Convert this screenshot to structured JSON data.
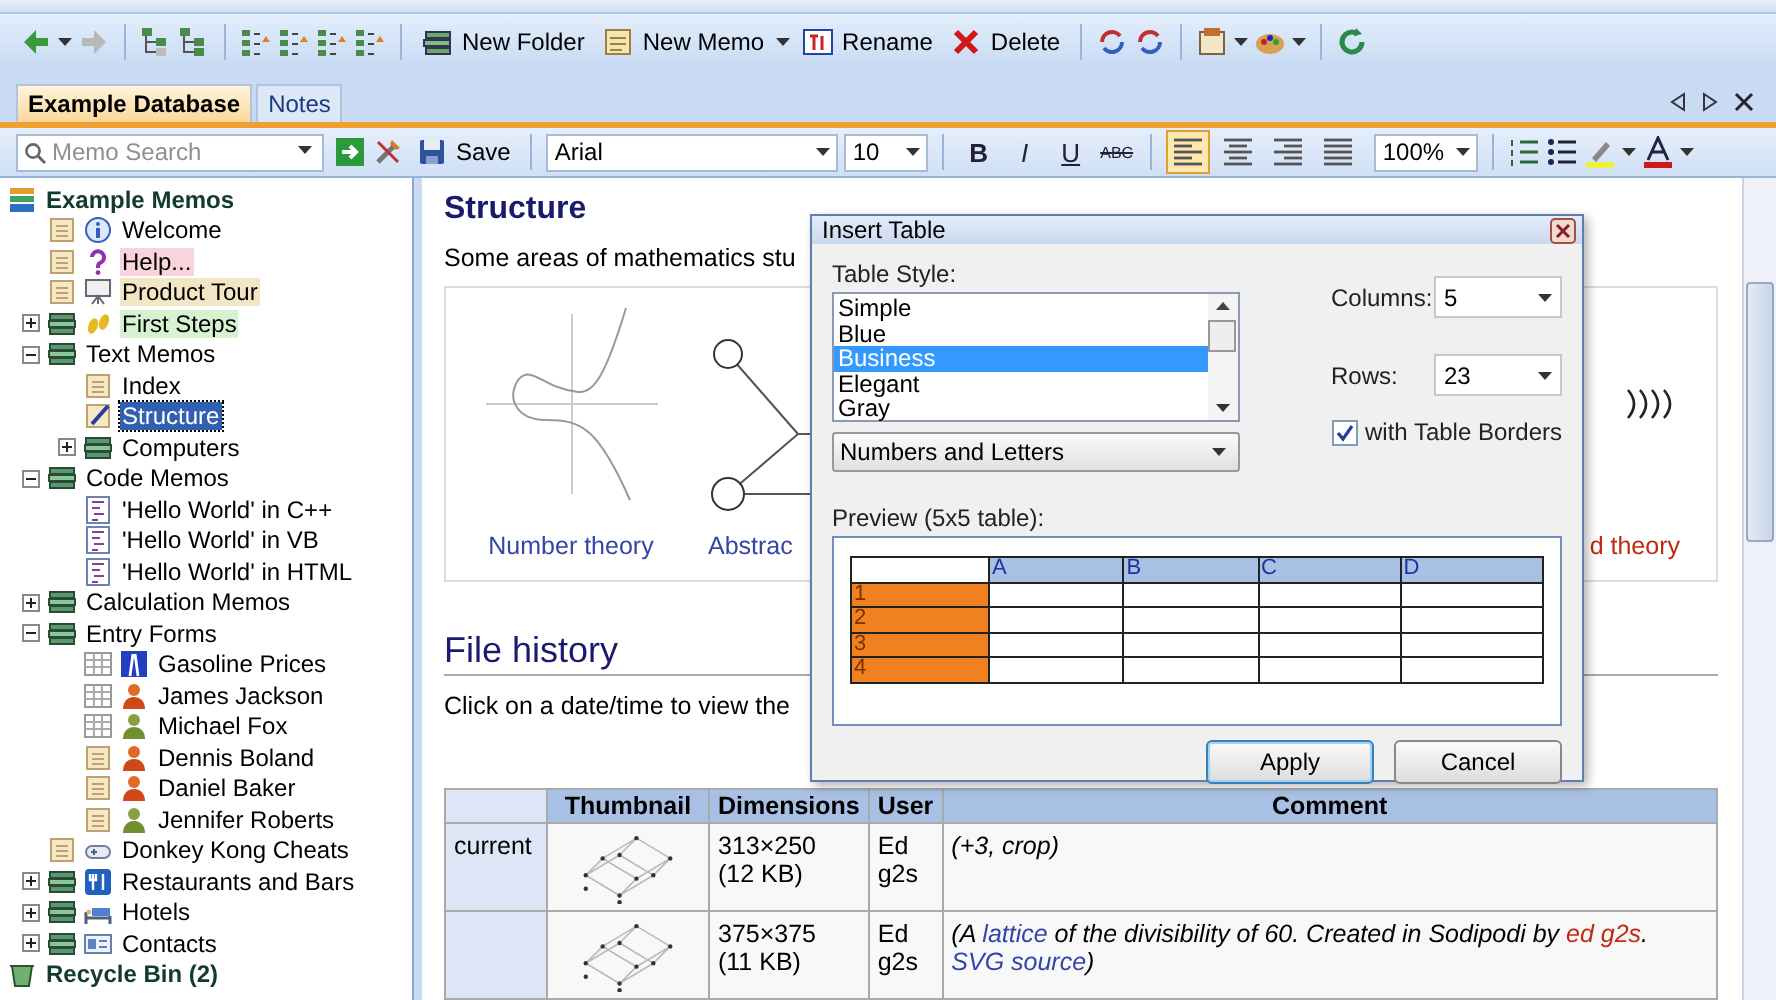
{
  "toolbar": {
    "buttons": [
      {
        "label": "New Folder",
        "kind": "folder",
        "dropdown": false
      },
      {
        "label": "New Memo",
        "kind": "memo",
        "dropdown": true
      },
      {
        "label": "Rename",
        "kind": "rename",
        "dropdown": false
      },
      {
        "label": "Delete",
        "kind": "delete",
        "dropdown": false
      }
    ]
  },
  "tabs": [
    {
      "label": "Example Database",
      "selected": true
    },
    {
      "label": "Notes",
      "selected": false
    }
  ],
  "format_bar": {
    "search": {
      "placeholder": "Memo Search"
    },
    "save": "Save",
    "font": "Arial",
    "size": "10",
    "bold": "B",
    "italic": "I",
    "underline": "U",
    "strikethrough": "ABC",
    "alignments": [
      {
        "kind": "left",
        "selected": true
      },
      {
        "kind": "center",
        "selected": false
      },
      {
        "kind": "right",
        "selected": false
      },
      {
        "kind": "justify",
        "selected": false
      }
    ],
    "zoom": "100%"
  },
  "tree": {
    "label": "Example Memos",
    "selected": false,
    "children": [
      {
        "label": "Welcome",
        "kind": "info-memo",
        "selected": false
      },
      {
        "label": "Help...",
        "kind": "help-memo",
        "color": "#fad4dc",
        "selected": false
      },
      {
        "label": "Product Tour",
        "kind": "tour-memo",
        "color": "#f2e6c4",
        "selected": false
      },
      {
        "label": "First Steps",
        "kind": "steps-folder",
        "color": "#d6f2d0",
        "expanded": false,
        "selected": false
      },
      {
        "label": "Text Memos",
        "kind": "folder",
        "expanded": true,
        "selected": false,
        "children": [
          {
            "label": "Index",
            "kind": "memo",
            "selected": false
          },
          {
            "label": "Structure",
            "kind": "edit-memo",
            "selected": true
          },
          {
            "label": "Computers",
            "kind": "folder",
            "expanded": false,
            "selected": false
          }
        ]
      },
      {
        "label": "Code Memos",
        "kind": "folder",
        "expanded": true,
        "selected": false,
        "children": [
          {
            "label": "'Hello World' in C++",
            "kind": "code-memo",
            "selected": false
          },
          {
            "label": "'Hello World' in VB",
            "kind": "code-memo",
            "selected": false
          },
          {
            "label": "'Hello World' in HTML",
            "kind": "code-memo",
            "selected": false
          }
        ]
      },
      {
        "label": "Calculation Memos",
        "kind": "folder",
        "expanded": false,
        "selected": false
      },
      {
        "label": "Entry Forms",
        "kind": "folder",
        "expanded": true,
        "selected": false,
        "children": [
          {
            "label": "Gasoline Prices",
            "kind": "road-form",
            "selected": false
          },
          {
            "label": "James Jackson",
            "kind": "person-form",
            "selected": false
          },
          {
            "label": "Michael Fox",
            "kind": "person-alt-form",
            "selected": false
          },
          {
            "label": "Dennis Boland",
            "kind": "person-memo",
            "selected": false
          },
          {
            "label": "Daniel Baker",
            "kind": "person-memo",
            "selected": false
          },
          {
            "label": "Jennifer Roberts",
            "kind": "person-alt-memo",
            "selected": false
          }
        ]
      },
      {
        "label": "Donkey Kong Cheats",
        "kind": "game-memo",
        "selected": false
      },
      {
        "label": "Restaurants and Bars",
        "kind": "food-folder",
        "expanded": false,
        "selected": false
      },
      {
        "label": "Hotels",
        "kind": "hotel-folder",
        "expanded": false,
        "selected": false
      },
      {
        "label": "Contacts",
        "kind": "contact-folder",
        "expanded": false,
        "selected": false
      }
    ]
  },
  "recycle_bin": "Recycle Bin (2)",
  "document": {
    "heading": "Structure",
    "intro": "Some areas of mathematics stu",
    "gallery": [
      {
        "caption": "Number theory",
        "kind": "link"
      },
      {
        "caption": "Abstrac",
        "kind": "link"
      },
      {
        "caption": "d theory",
        "kind": "missing-link"
      }
    ],
    "history_heading": "File history",
    "history_intro": "Click on a date/time to view the",
    "columns": [
      "Thumbnail",
      "Dimensions",
      "User",
      "Comment"
    ],
    "rows": [
      {
        "version": "current",
        "dimensions": "313×250",
        "size": "(12 KB)",
        "user": "Ed g2s",
        "comment": [
          {
            "text": "(+3, crop)",
            "kind": "text"
          }
        ]
      },
      {
        "dimensions": "375×375",
        "size": "(11 KB)",
        "user": "Ed g2s",
        "comment": [
          {
            "text": "(A ",
            "kind": "text"
          },
          {
            "text": "lattice",
            "kind": "link"
          },
          {
            "text": " of the divisibility of 60. Created in Sodipodi by ",
            "kind": "text"
          },
          {
            "text": "ed g2s",
            "kind": "missing-link"
          },
          {
            "text": ". ",
            "kind": "text"
          },
          {
            "text": "SVG source",
            "kind": "link"
          },
          {
            "text": ")",
            "kind": "text"
          }
        ]
      }
    ]
  },
  "dialog": {
    "title": "Insert Table",
    "style_label": "Table Style:",
    "styles": [
      {
        "label": "Simple",
        "selected": false
      },
      {
        "label": "Blue",
        "selected": false
      },
      {
        "label": "Business",
        "selected": true
      },
      {
        "label": "Elegant",
        "selected": false
      },
      {
        "label": "Gray",
        "selected": false
      }
    ],
    "numbering": "Numbers and Letters",
    "columns_label": "Columns:",
    "columns": "5",
    "rows_label": "Rows:",
    "rows": "23",
    "borders": {
      "label": "with Table Borders",
      "checked": true
    },
    "preview_label": "Preview (5x5 table):",
    "preview": {
      "headers": [
        "A",
        "B",
        "C",
        "D"
      ],
      "rows": [
        "1",
        "2",
        "3",
        "4"
      ]
    },
    "buttons": [
      {
        "label": "Apply",
        "default": true
      },
      {
        "label": "Cancel",
        "default": false
      }
    ]
  }
}
